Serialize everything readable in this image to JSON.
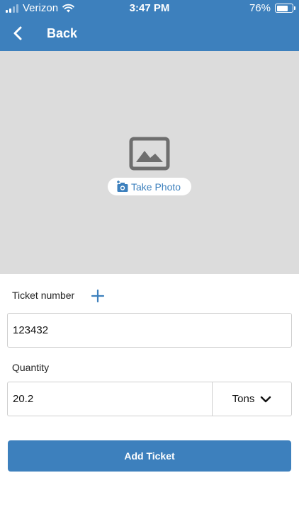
{
  "status_bar": {
    "carrier": "Verizon",
    "time": "3:47 PM",
    "battery": "76%",
    "battery_level": 0.76
  },
  "nav": {
    "back_label": "Back"
  },
  "photo": {
    "take_photo_label": "Take Photo"
  },
  "form": {
    "ticket_number_label": "Ticket number",
    "ticket_number_value": "123432",
    "quantity_label": "Quantity",
    "quantity_value": "20.2",
    "unit_selected": "Tons",
    "submit_label": "Add Ticket"
  },
  "colors": {
    "accent": "#3d80bd",
    "photo_background": "#dcdcdc"
  },
  "icons": {
    "back": "chevron-left-icon",
    "image_placeholder": "image-icon",
    "camera": "camera-add-icon",
    "add_field": "plus-icon",
    "unit_dropdown": "chevron-down-icon"
  }
}
